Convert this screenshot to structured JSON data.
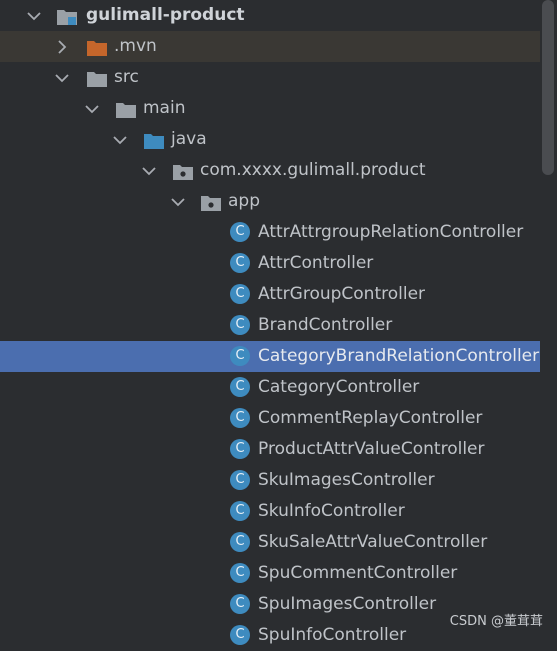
{
  "tree": {
    "project": "gulimall-product",
    "mvn": ".mvn",
    "src": "src",
    "main": "main",
    "java": "java",
    "package": "com.xxxx.gulimall.product",
    "app": "app",
    "class_icon_letter": "C",
    "classes": [
      "AttrAttrgroupRelationController",
      "AttrController",
      "AttrGroupController",
      "BrandController",
      "CategoryBrandRelationController",
      "CategoryController",
      "CommentReplayController",
      "ProductAttrValueController",
      "SkuImagesController",
      "SkuInfoController",
      "SkuSaleAttrValueController",
      "SpuCommentController",
      "SpuImagesController",
      "SpuInfoController"
    ],
    "selected_class": "CategoryBrandRelationController"
  },
  "colors": {
    "background": "#2b2d30",
    "selection": "#4b6eaf",
    "class_icon": "#3e8bbf",
    "mvn_folder": "#c5662b",
    "java_folder": "#3e8bbf",
    "folder": "#9aa0a6"
  },
  "watermark": "CSDN @董茸茸"
}
